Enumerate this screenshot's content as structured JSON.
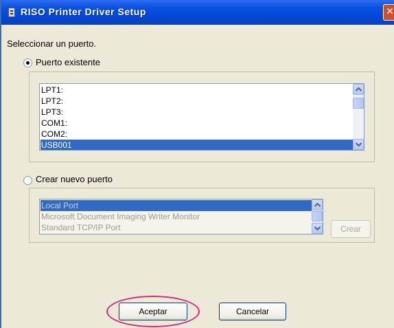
{
  "window": {
    "title": "RISO Printer Driver Setup",
    "close_glyph": "✕"
  },
  "instruction": "Seleccionar un puerto.",
  "existing_port": {
    "label": "Puerto existente",
    "checked": true,
    "ports": [
      "LPT1:",
      "LPT2:",
      "LPT3:",
      "COM1:",
      "COM2:",
      "USB001"
    ],
    "selected": "USB001"
  },
  "new_port": {
    "label": "Crear nuevo puerto",
    "checked": false,
    "types": [
      "Local Port",
      "Microsoft Document Imaging Writer Monitor",
      "Standard TCP/IP Port"
    ],
    "selected": "Local Port",
    "create_label": "Crear"
  },
  "buttons": {
    "ok": "Aceptar",
    "cancel": "Cancelar"
  },
  "colors": {
    "titlebar": "#0347d8",
    "selection": "#316ac5",
    "callout": "#d6277e"
  },
  "icons": {
    "title": "printer-icon",
    "close": "close-icon",
    "up": "scroll-up-arrow-icon",
    "down": "scroll-down-arrow-icon"
  }
}
